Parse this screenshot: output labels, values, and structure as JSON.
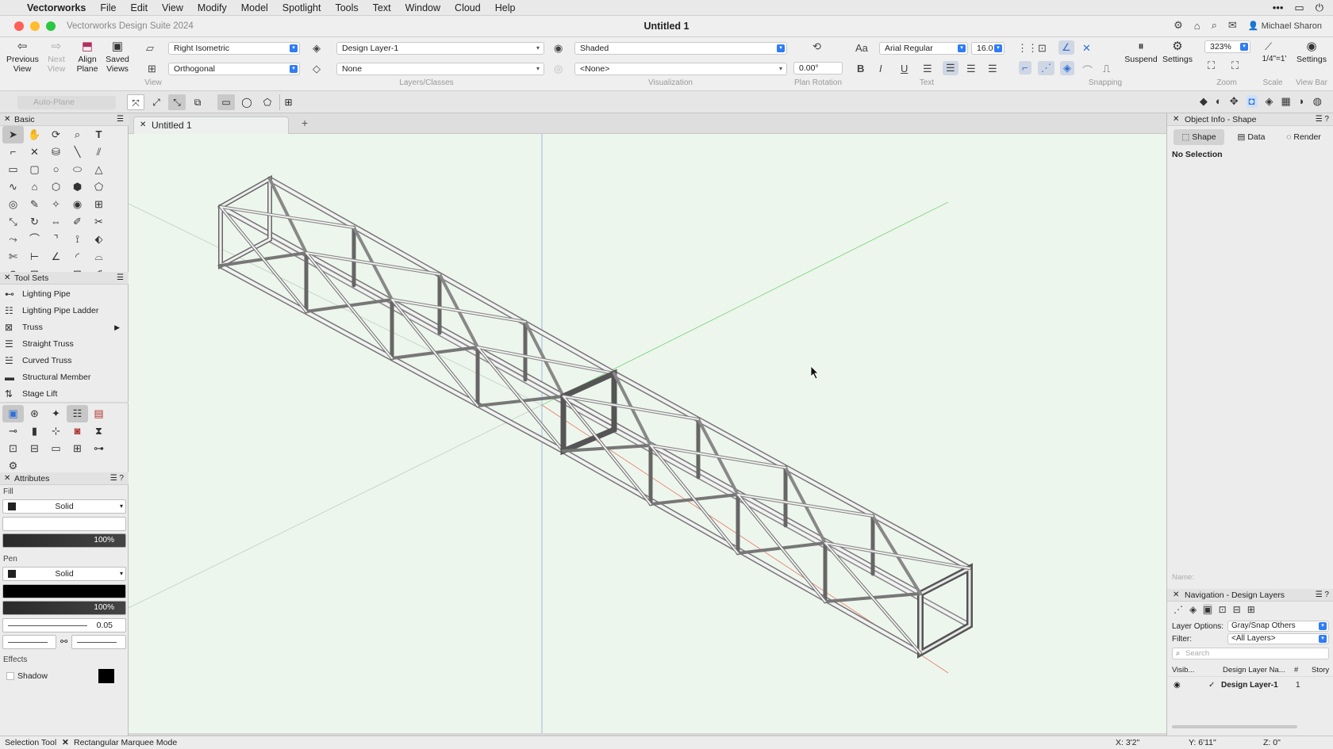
{
  "menubar": {
    "app": "Vectorworks",
    "items": [
      "File",
      "Edit",
      "View",
      "Modify",
      "Model",
      "Spotlight",
      "Tools",
      "Text",
      "Window",
      "Cloud",
      "Help"
    ]
  },
  "window": {
    "app_title": "Vectorworks Design Suite 2024",
    "doc_title": "Untitled 1",
    "user": "Michael Sharon"
  },
  "toolbar": {
    "previous_view": "Previous View",
    "next_view": "Next View",
    "align_plane": "Align Plane",
    "saved_views": "Saved Views",
    "view_group": "View",
    "projection_view": "Right Isometric",
    "projection": "Orthogonal",
    "layer": "Design Layer-1",
    "class": "None",
    "layers_group": "Layers/Classes",
    "render_mode": "Shaded",
    "render_style": "<None>",
    "visualization_group": "Visualization",
    "plan_rotation_value": "0.00°",
    "plan_rotation_group": "Plan Rotation",
    "font": "Arial Regular",
    "font_size": "16.0",
    "text_group": "Text",
    "snapping_group": "Snapping",
    "suspend": "Suspend",
    "settings": "Settings",
    "zoom_value": "323%",
    "zoom_group": "Zoom",
    "scale_value": "1/4\"=1'",
    "scale_group": "Scale",
    "viewbar_settings": "Settings",
    "viewbar_group": "View Bar",
    "auto_plane": "Auto-Plane"
  },
  "palettes": {
    "basic_title": "Basic",
    "toolsets_title": "Tool Sets",
    "toolsets": [
      {
        "label": "Lighting Pipe",
        "icon": "pipe-icon"
      },
      {
        "label": "Lighting Pipe Ladder",
        "icon": "ladder-icon"
      },
      {
        "label": "Truss",
        "icon": "truss-icon"
      },
      {
        "label": "Straight Truss",
        "icon": "straight-truss-icon"
      },
      {
        "label": "Curved Truss",
        "icon": "curved-truss-icon"
      },
      {
        "label": "Structural Member",
        "icon": "beam-icon"
      },
      {
        "label": "Stage Lift",
        "icon": "lift-icon"
      }
    ],
    "attributes_title": "Attributes",
    "fill_label": "Fill",
    "fill_style": "Solid",
    "fill_opacity": "100%",
    "pen_label": "Pen",
    "pen_style": "Solid",
    "pen_opacity": "100%",
    "line_weight": "0.05",
    "effects_label": "Effects",
    "shadow_label": "Shadow"
  },
  "object_info": {
    "title": "Object Info - Shape",
    "tabs": [
      "Shape",
      "Data",
      "Render"
    ],
    "selection": "No Selection",
    "name_label": "Name:"
  },
  "navigation": {
    "title": "Navigation - Design Layers",
    "layer_options_label": "Layer Options:",
    "layer_options_value": "Gray/Snap Others",
    "filter_label": "Filter:",
    "filter_value": "<All Layers>",
    "search_placeholder": "Search",
    "columns": [
      "Visib...",
      "Design Layer Na...",
      "#",
      "Story"
    ],
    "rows": [
      {
        "name": "Design Layer-1",
        "number": "1"
      }
    ]
  },
  "status": {
    "tool": "Selection Tool",
    "mode": "Rectangular Marquee Mode",
    "x": "X: 3'2\"",
    "y": "Y: 6'11\"",
    "z": "Z: 0\""
  },
  "colors": {
    "canvas_bg": "#edf6ec",
    "accent": "#2f7cf6",
    "x_axis": "#e87a6a",
    "y_axis": "#7fd47f",
    "z_axis": "#8aa7e6"
  }
}
